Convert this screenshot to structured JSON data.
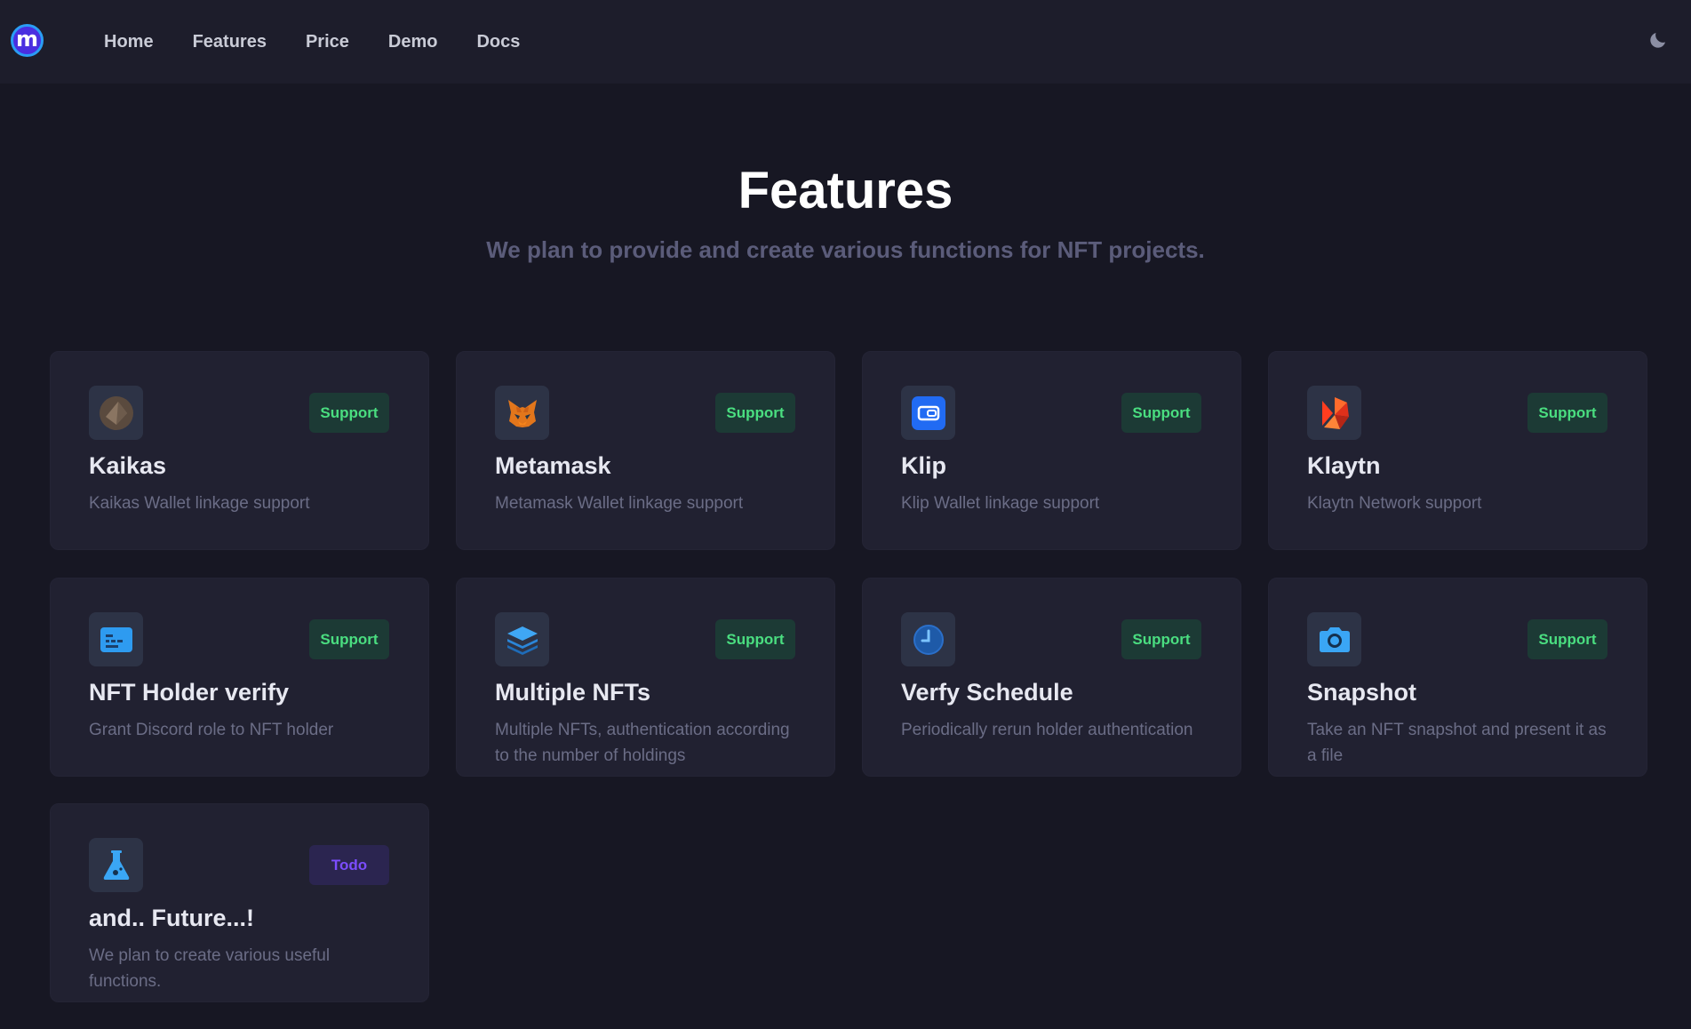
{
  "nav": {
    "logo_letter": "m",
    "links": [
      "Home",
      "Features",
      "Price",
      "Demo",
      "Docs"
    ],
    "theme_icon": "moon-icon"
  },
  "hero": {
    "title": "Features",
    "subtitle": "We plan to provide and create various functions for NFT projects."
  },
  "badges": {
    "support": "Support",
    "todo": "Todo"
  },
  "colors": {
    "background": "#171723",
    "navbar": "#1d1d2b",
    "card": "#212131",
    "support_text": "#4ade80",
    "todo_text": "#7c4dff"
  },
  "cards": [
    {
      "title": "Kaikas",
      "desc": "Kaikas Wallet linkage support",
      "badge": "Support",
      "icon": "kaikas-icon"
    },
    {
      "title": "Metamask",
      "desc": "Metamask Wallet linkage support",
      "badge": "Support",
      "icon": "metamask-fox-icon"
    },
    {
      "title": "Klip",
      "desc": "Klip Wallet linkage support",
      "badge": "Support",
      "icon": "klip-icon"
    },
    {
      "title": "Klaytn",
      "desc": "Klaytn Network support",
      "badge": "Support",
      "icon": "klaytn-icon"
    },
    {
      "title": "NFT Holder verify",
      "desc": "Grant Discord role to NFT holder",
      "badge": "Support",
      "icon": "id-card-icon"
    },
    {
      "title": "Multiple NFTs",
      "desc": "Multiple NFTs, authentication according to the number of holdings",
      "badge": "Support",
      "icon": "layers-icon"
    },
    {
      "title": "Verfy Schedule",
      "desc": "Periodically rerun holder authentication",
      "badge": "Support",
      "icon": "clock-icon"
    },
    {
      "title": "Snapshot",
      "desc": "Take an NFT snapshot and present it as a file",
      "badge": "Support",
      "icon": "camera-icon"
    },
    {
      "title": "and.. Future...!",
      "desc": "We plan to create various useful functions.",
      "badge": "Todo",
      "icon": "flask-icon"
    }
  ]
}
